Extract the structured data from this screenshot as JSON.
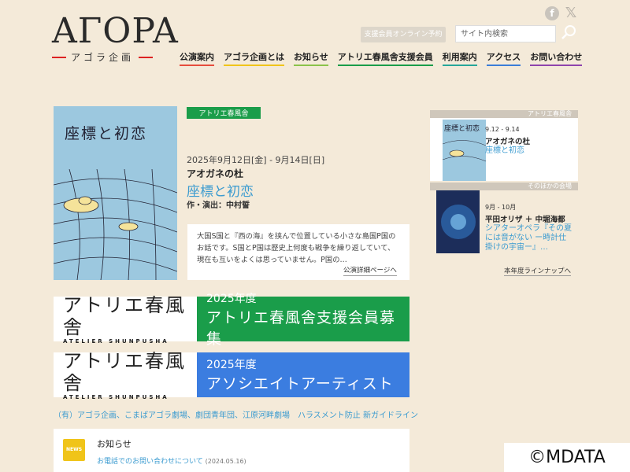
{
  "header": {
    "logo_main": "AΓOPA",
    "logo_sub": "アゴラ企画",
    "reservation_button": "支援会員オンライン予約",
    "search_placeholder": "サイト内検索",
    "social": {
      "facebook": "facebook-icon",
      "x": "x-icon"
    },
    "nav": [
      {
        "label": "公演案内",
        "color": "#e64c3c"
      },
      {
        "label": "アゴラ企画とは",
        "color": "#f0c419"
      },
      {
        "label": "お知らせ",
        "color": "#8bc34a"
      },
      {
        "label": "アトリエ春風舎支援会員",
        "color": "#1a9d4a"
      },
      {
        "label": "利用案内",
        "color": "#26a69a"
      },
      {
        "label": "アクセス",
        "color": "#3b7dd8"
      },
      {
        "label": "お問い合わせ",
        "color": "#8e44ad"
      }
    ]
  },
  "featured": {
    "tag": "アトリエ春風舎",
    "date": "2025年9月12日[金] - 9月14日[日]",
    "company": "アオガネの杜",
    "title": "座標と初恋",
    "credit": "作・演出：中村誓",
    "description": "大国S国と『西の海』を挟んで位置している小さな島国P国のお話です。S国とP国は歴史上何度も戦争を繰り返していて、現在も互いをよくは思っていません。P国の…",
    "more": "公演詳細ページへ",
    "poster_title": "座標と初恋"
  },
  "sidebar": {
    "label1": "アトリエ春風舎",
    "card1": {
      "date": "9.12 - 9.14",
      "company": "アオガネの杜",
      "title": "座標と初恋",
      "poster_title": "座標と初恋"
    },
    "label2": "そのほかの会場",
    "card2": {
      "date": "9月 - 10月",
      "company": "平田オリザ ＋ 中堀海都",
      "title": "シアターオペラ『その夏には音がない ー時計仕掛けの宇宙ー』…"
    },
    "lineup": "本年度ラインナップへ"
  },
  "banners": [
    {
      "logo": "アトリエ春風舎",
      "logo_sub": "ATELIER SHUNPUSHA",
      "year": "2025年度",
      "text": "アトリエ春風舎支援会員募集",
      "color": "#1a9d4a"
    },
    {
      "logo": "アトリエ春風舎",
      "logo_sub": "ATELIER SHUNPUSHA",
      "year": "2025年度",
      "text": "アソシエイトアーティスト",
      "color": "#3b7de0"
    }
  ],
  "links_text": "（有）アゴラ企画、こまばアゴラ劇場、劇団青年団、江原河畔劇場　ハラスメント防止 新ガイドライン",
  "news": {
    "icon_label": "NEWS",
    "title": "お知らせ",
    "item_text": "お電話でのお問い合わせについて",
    "item_date": "(2024.05.16)"
  },
  "watermark": "©MDATA"
}
